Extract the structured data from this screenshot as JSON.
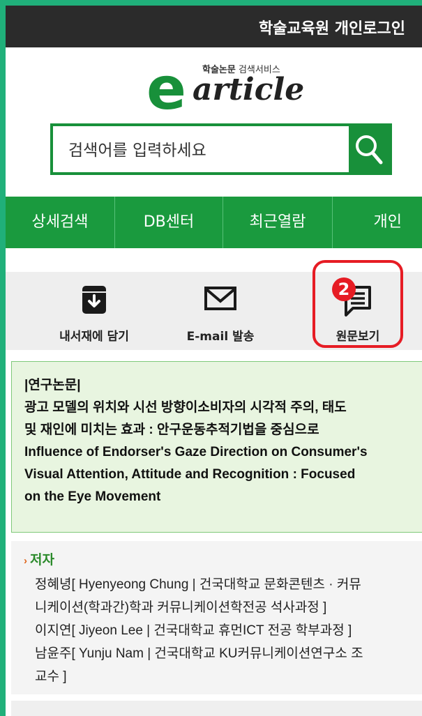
{
  "header": {
    "login_link": "학술교육원 개인로그인"
  },
  "logo": {
    "tag_bold": "학술논문",
    "tag_light": " 검색서비스",
    "letter": "e",
    "word": "article"
  },
  "search": {
    "placeholder": "검색어를 입력하세요",
    "icon": "search-icon"
  },
  "nav": {
    "items": [
      "상세검색",
      "DB센터",
      "최근열람",
      "개인"
    ]
  },
  "actions": [
    {
      "label": "내서재에 담기",
      "icon": "library-save-icon"
    },
    {
      "label": "E-mail 발송",
      "icon": "mail-icon"
    },
    {
      "label": "원문보기",
      "icon": "document-icon"
    }
  ],
  "annotation": {
    "badge": "2"
  },
  "paper": {
    "category": "|연구논문|",
    "title_ko_1": "광고 모델의 위치와 시선 방향이소비자의 시각적 주의, 태도",
    "title_ko_2": "및 재인에 미치는 효과 : 안구운동추적기법을 중심으로",
    "title_en_1": "Influence of Endorser's Gaze Direction on Consumer's",
    "title_en_2": "Visual Attention, Attitude and Recognition : Focused",
    "title_en_3": "on the Eye Movement"
  },
  "authors": {
    "heading": "저자",
    "lines": [
      "정혜녕[ Hyenyeong Chung | 건국대학교 문화콘텐츠 · 커뮤",
      "니케이션(학과간)학과 커뮤니케이션학전공 석사과정 ]",
      "이지연[ Jiyeon Lee | 건국대학교 휴먼ICT 전공 학부과정 ]",
      "남윤주[ Yunju Nam | 건국대학교 KU커뮤니케이션연구소 조",
      "교수 ]"
    ]
  },
  "colors": {
    "brand_green": "#1a9a3e",
    "highlight_red": "#e61c24",
    "frame": "#20b07a"
  }
}
